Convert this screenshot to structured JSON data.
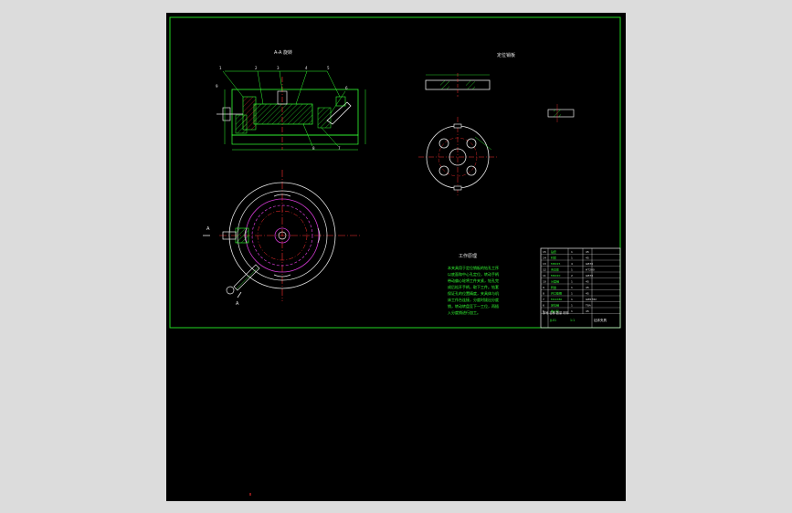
{
  "sheet": {
    "background": "#000000",
    "page_background": "#dcdcdc"
  },
  "colors": {
    "border": "#22d822",
    "outline": "#33ff33",
    "centerline": "#ff3030",
    "hidden": "#d23ad2",
    "white": "#e8e8e8",
    "hatch": "#33ff33"
  },
  "views": {
    "section_title": "A-A 旋转",
    "part_title": "定位销板",
    "section_marker": "A"
  },
  "leaders": [
    "1",
    "2",
    "3",
    "4",
    "5",
    "6",
    "7",
    "8",
    "9"
  ],
  "notes": {
    "heading": "工作原理",
    "lines": [
      "本夹具用于定位销板的钻孔工序",
      "以底面和中心孔定位，转动手柄",
      "带动偏心轮将工件夹紧，钻孔完",
      "成后松开手柄，取下工件。钻套",
      "保证孔的位置精度，夹具体与机",
      "床工作台连接，分度时拔出分度",
      "销，转动转盘至下一工位，再插",
      "入分度销进行加工。"
    ]
  },
  "title_block": {
    "rows": [
      [
        "15",
        "钻套",
        "1",
        "45"
      ],
      [
        "14",
        "衬套",
        "1",
        "45"
      ],
      [
        "13",
        "M8X25",
        "4",
        "GB70"
      ],
      [
        "12",
        "夹具体",
        "1",
        "HT200"
      ],
      [
        "11",
        "M6X20",
        "2",
        "GB70"
      ],
      [
        "10",
        "分度销",
        "1",
        "45"
      ],
      [
        "9",
        "转盘",
        "1",
        "45"
      ],
      [
        "8",
        "开口垫圈",
        "1",
        "45"
      ],
      [
        "7",
        "M12X80",
        "1",
        "GB5782"
      ],
      [
        "6",
        "定位销",
        "1",
        "T8A"
      ],
      [
        "5",
        "偏心轮",
        "1",
        "45"
      ]
    ],
    "footer": "序号 名称 数量 材料",
    "drawing_no": "JJ-01",
    "scale": "1:1",
    "name": "钻床夹具"
  }
}
